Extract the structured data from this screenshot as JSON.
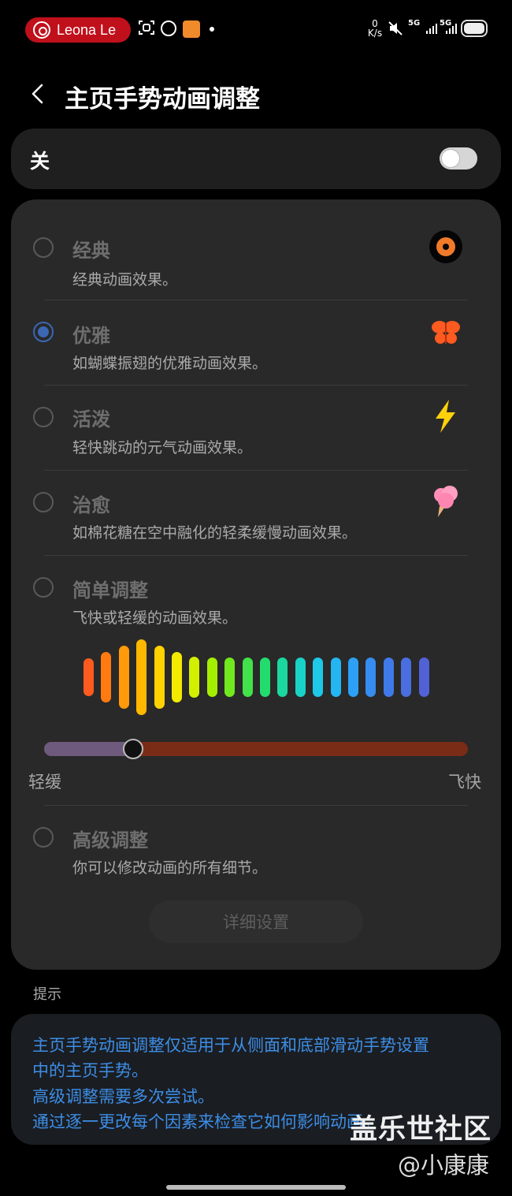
{
  "status_bar": {
    "app_pill": "Leona Le",
    "speed_value": "0",
    "speed_unit": "K/s",
    "net1": "5G",
    "net2": "5G"
  },
  "header": {
    "title": "主页手势动画调整"
  },
  "toggle": {
    "label": "关",
    "on": false
  },
  "options": [
    {
      "title": "经典",
      "desc": "经典动画效果。",
      "selected": false,
      "icon": "vinyl-record-icon"
    },
    {
      "title": "优雅",
      "desc": "如蝴蝶振翅的优雅动画效果。",
      "selected": true,
      "icon": "butterfly-icon"
    },
    {
      "title": "活泼",
      "desc": "轻快跳动的元气动画效果。",
      "selected": false,
      "icon": "lightning-icon"
    },
    {
      "title": "治愈",
      "desc": "如棉花糖在空中融化的轻柔缓慢动画效果。",
      "selected": false,
      "icon": "cotton-candy-icon"
    },
    {
      "title": "简单调整",
      "desc": "飞快或轻缓的动画效果。",
      "selected": false
    },
    {
      "title": "高级调整",
      "desc": "你可以修改动画的所有细节。",
      "selected": false
    }
  ],
  "speed_slider": {
    "min_label": "轻缓",
    "max_label": "飞快",
    "value_fraction": 0.21
  },
  "detail_button": "详细设置",
  "hint": {
    "title": "提示",
    "lines": [
      "主页手势动画调整仅适用于从侧面和底部滑动手势设置",
      "中的主页手势。",
      "高级调整需要多次尝试。",
      "通过逐一更改每个因素来检查它如何影响动画。"
    ]
  },
  "watermark": {
    "site": "盖乐世社区",
    "author": "@小康康"
  },
  "colors": {
    "accent": "#3b67b5",
    "hint_text": "#3d8ee6",
    "pill": "#c0101b"
  }
}
